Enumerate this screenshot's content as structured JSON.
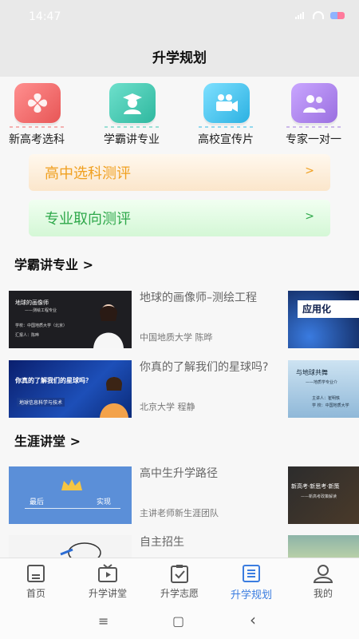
{
  "status": {
    "time": "14:47"
  },
  "header": {
    "title": "升学规划"
  },
  "quick": [
    {
      "label": "新高考选科",
      "icon": "clover-grid-icon",
      "color": "#ef6b6b"
    },
    {
      "label": "学霸讲专业",
      "icon": "graduate-avatar-icon",
      "color": "#3cc7b0"
    },
    {
      "label": "高校宣传片",
      "icon": "video-camera-icon",
      "color": "#2fb8e6"
    },
    {
      "label": "专家一对一",
      "icon": "expert-chat-icon",
      "color": "#a27bdc"
    }
  ],
  "evaluations": [
    {
      "label": "高中选科测评",
      "chevron": ">"
    },
    {
      "label": "专业取向测评",
      "chevron": ">"
    }
  ],
  "sections": {
    "xueba": {
      "title": "学霸讲专业 >",
      "items": [
        {
          "title": "地球的画像师–测绘工程",
          "meta": "中国地质大学   陈晔",
          "thumb_text": [
            "地球的画像师",
            "——测绘工程专业",
            "学校：中国地质大学（北京）",
            "汇报人：陈晔"
          ]
        },
        {
          "title": "你真的了解我们的星球吗?",
          "meta": "北京大学   程静",
          "thumb_text": [
            "你真的了解我们的星球吗？",
            "地球信息科学与技术"
          ]
        }
      ],
      "side_thumbs": [
        {
          "text": [
            "应用化"
          ]
        },
        {
          "text": [
            "与地球共舞",
            "——地质学专业介",
            "主讲人：崔明轶",
            "学  校：中国地质大学"
          ]
        }
      ]
    },
    "career": {
      "title": "生涯讲堂 >",
      "items": [
        {
          "title": "高中生升学路径",
          "meta": "主讲老师新生涯团队",
          "thumb_text": [
            "最后",
            "实现"
          ]
        },
        {
          "title": "自主招生",
          "meta": "",
          "thumb_text": []
        }
      ],
      "side_thumbs": [
        {
          "text": [
            "新高考·新思考·新策",
            "——新高考政策解读"
          ]
        }
      ]
    }
  },
  "tabs": [
    {
      "label": "首页",
      "icon": "document-icon",
      "active": false
    },
    {
      "label": "升学讲堂",
      "icon": "tv-play-icon",
      "active": false
    },
    {
      "label": "升学志愿",
      "icon": "clipboard-check-icon",
      "active": false
    },
    {
      "label": "升学规划",
      "icon": "list-document-icon",
      "active": true
    },
    {
      "label": "我的",
      "icon": "user-icon",
      "active": false
    }
  ],
  "system_nav": {
    "menu": "≡",
    "home": "▢",
    "back": "‹"
  }
}
